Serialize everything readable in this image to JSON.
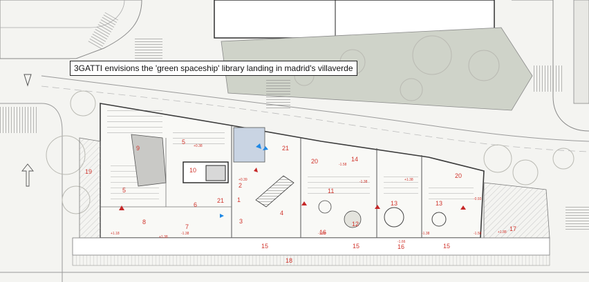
{
  "caption": "3GATTI envisions the 'green spaceship' library landing in madrid's villaverde",
  "colors": {
    "background": "#f4f4f1",
    "building_line": "#3a3a3a",
    "label_red": "#d0342c",
    "vegetation_fill": "#cfd3c9",
    "accent_blue": "#1e88e5",
    "courtyard_blue": "#c9d4e3"
  },
  "space_labels": [
    "1",
    "2",
    "3",
    "4",
    "5",
    "5",
    "6",
    "7",
    "8",
    "9",
    "10",
    "11",
    "12",
    "13",
    "13",
    "14",
    "15",
    "15",
    "15",
    "16",
    "16",
    "17",
    "18",
    "19",
    "20",
    "20",
    "21",
    "21"
  ],
  "level_marks": [
    "+0.38",
    "+0.39",
    "+1.18",
    "-1.38",
    "-1.88",
    "-1.66",
    "-1.38",
    "-1.38",
    "-1.58",
    "-1.58",
    "+1.38",
    "+1.88",
    "+1.38",
    "-0.93"
  ],
  "icons": [
    "north-arrow-icon",
    "entrance-arrow-icon",
    "section-marker-icon"
  ]
}
